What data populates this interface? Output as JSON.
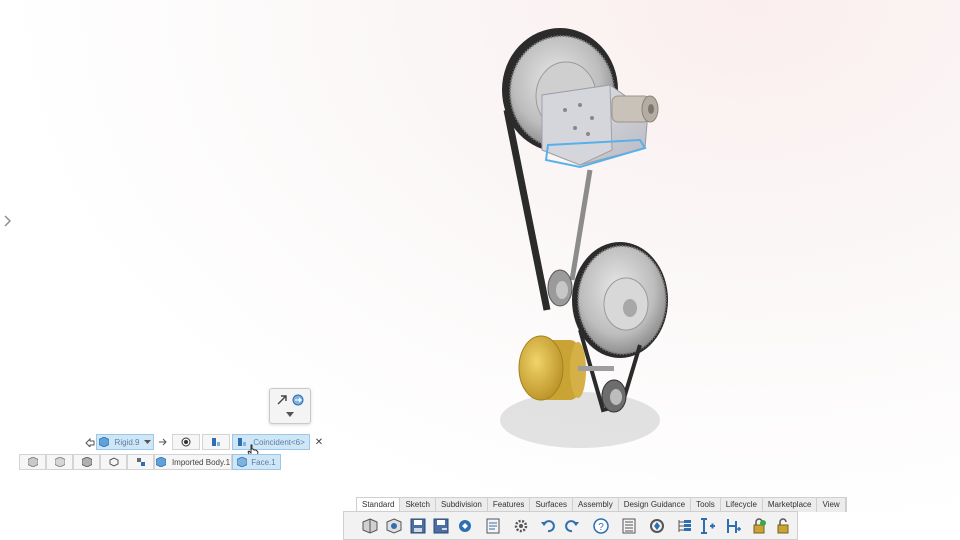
{
  "viewport": {
    "description_icon": "gear-belt-assembly-model"
  },
  "mate_popup": {
    "icons": [
      "align-arrow-icon",
      "flip-icon",
      "chevron-down-icon"
    ]
  },
  "mate_row": {
    "mate_type": "Rigid.9",
    "selection": "Coincident<6>",
    "close": "✕"
  },
  "entity_row": {
    "body": "Imported Body.1",
    "face": "Face.1"
  },
  "command_manager": {
    "tabs": [
      "Standard",
      "Sketch",
      "Subdivision",
      "Features",
      "Surfaces",
      "Assembly",
      "Design Guidance",
      "Tools",
      "Lifecycle",
      "Marketplace",
      "View"
    ],
    "active_tab": "Standard",
    "tools": [
      "new-part-icon",
      "open-icon",
      "save-icon",
      "save-as-icon",
      "rebuild-icon",
      "properties-icon",
      "options-icon",
      "undo-icon",
      "redo-icon",
      "help-icon",
      "list-icon",
      "reload-icon",
      "feature-tree-icon",
      "insert-icon",
      "structure-icon",
      "lock-icon",
      "unlock-icon"
    ]
  },
  "colors": {
    "accent": "#2e6fb0",
    "selection": "#cfe6f7",
    "belt": "#2b2b2b",
    "motor": "#d9b443"
  }
}
